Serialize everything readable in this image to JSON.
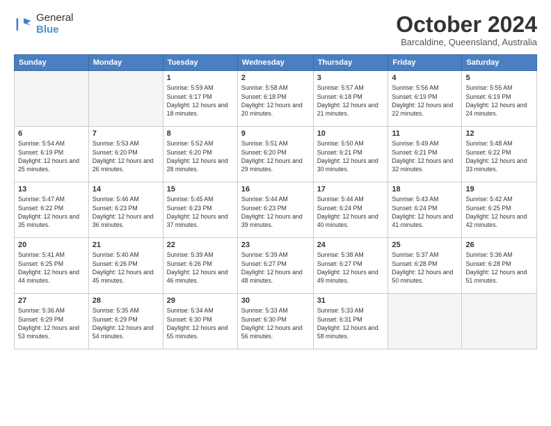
{
  "logo": {
    "general": "General",
    "blue": "Blue"
  },
  "header": {
    "month": "October 2024",
    "location": "Barcaldine, Queensland, Australia"
  },
  "days_of_week": [
    "Sunday",
    "Monday",
    "Tuesday",
    "Wednesday",
    "Thursday",
    "Friday",
    "Saturday"
  ],
  "weeks": [
    [
      {
        "day": "",
        "sunrise": "",
        "sunset": "",
        "daylight": ""
      },
      {
        "day": "",
        "sunrise": "",
        "sunset": "",
        "daylight": ""
      },
      {
        "day": "1",
        "sunrise": "Sunrise: 5:59 AM",
        "sunset": "Sunset: 6:17 PM",
        "daylight": "Daylight: 12 hours and 18 minutes."
      },
      {
        "day": "2",
        "sunrise": "Sunrise: 5:58 AM",
        "sunset": "Sunset: 6:18 PM",
        "daylight": "Daylight: 12 hours and 20 minutes."
      },
      {
        "day": "3",
        "sunrise": "Sunrise: 5:57 AM",
        "sunset": "Sunset: 6:18 PM",
        "daylight": "Daylight: 12 hours and 21 minutes."
      },
      {
        "day": "4",
        "sunrise": "Sunrise: 5:56 AM",
        "sunset": "Sunset: 6:19 PM",
        "daylight": "Daylight: 12 hours and 22 minutes."
      },
      {
        "day": "5",
        "sunrise": "Sunrise: 5:55 AM",
        "sunset": "Sunset: 6:19 PM",
        "daylight": "Daylight: 12 hours and 24 minutes."
      }
    ],
    [
      {
        "day": "6",
        "sunrise": "Sunrise: 5:54 AM",
        "sunset": "Sunset: 6:19 PM",
        "daylight": "Daylight: 12 hours and 25 minutes."
      },
      {
        "day": "7",
        "sunrise": "Sunrise: 5:53 AM",
        "sunset": "Sunset: 6:20 PM",
        "daylight": "Daylight: 12 hours and 26 minutes."
      },
      {
        "day": "8",
        "sunrise": "Sunrise: 5:52 AM",
        "sunset": "Sunset: 6:20 PM",
        "daylight": "Daylight: 12 hours and 28 minutes."
      },
      {
        "day": "9",
        "sunrise": "Sunrise: 5:51 AM",
        "sunset": "Sunset: 6:20 PM",
        "daylight": "Daylight: 12 hours and 29 minutes."
      },
      {
        "day": "10",
        "sunrise": "Sunrise: 5:50 AM",
        "sunset": "Sunset: 6:21 PM",
        "daylight": "Daylight: 12 hours and 30 minutes."
      },
      {
        "day": "11",
        "sunrise": "Sunrise: 5:49 AM",
        "sunset": "Sunset: 6:21 PM",
        "daylight": "Daylight: 12 hours and 32 minutes."
      },
      {
        "day": "12",
        "sunrise": "Sunrise: 5:48 AM",
        "sunset": "Sunset: 6:22 PM",
        "daylight": "Daylight: 12 hours and 33 minutes."
      }
    ],
    [
      {
        "day": "13",
        "sunrise": "Sunrise: 5:47 AM",
        "sunset": "Sunset: 6:22 PM",
        "daylight": "Daylight: 12 hours and 35 minutes."
      },
      {
        "day": "14",
        "sunrise": "Sunrise: 5:46 AM",
        "sunset": "Sunset: 6:23 PM",
        "daylight": "Daylight: 12 hours and 36 minutes."
      },
      {
        "day": "15",
        "sunrise": "Sunrise: 5:45 AM",
        "sunset": "Sunset: 6:23 PM",
        "daylight": "Daylight: 12 hours and 37 minutes."
      },
      {
        "day": "16",
        "sunrise": "Sunrise: 5:44 AM",
        "sunset": "Sunset: 6:23 PM",
        "daylight": "Daylight: 12 hours and 39 minutes."
      },
      {
        "day": "17",
        "sunrise": "Sunrise: 5:44 AM",
        "sunset": "Sunset: 6:24 PM",
        "daylight": "Daylight: 12 hours and 40 minutes."
      },
      {
        "day": "18",
        "sunrise": "Sunrise: 5:43 AM",
        "sunset": "Sunset: 6:24 PM",
        "daylight": "Daylight: 12 hours and 41 minutes."
      },
      {
        "day": "19",
        "sunrise": "Sunrise: 5:42 AM",
        "sunset": "Sunset: 6:25 PM",
        "daylight": "Daylight: 12 hours and 42 minutes."
      }
    ],
    [
      {
        "day": "20",
        "sunrise": "Sunrise: 5:41 AM",
        "sunset": "Sunset: 6:25 PM",
        "daylight": "Daylight: 12 hours and 44 minutes."
      },
      {
        "day": "21",
        "sunrise": "Sunrise: 5:40 AM",
        "sunset": "Sunset: 6:26 PM",
        "daylight": "Daylight: 12 hours and 45 minutes."
      },
      {
        "day": "22",
        "sunrise": "Sunrise: 5:39 AM",
        "sunset": "Sunset: 6:26 PM",
        "daylight": "Daylight: 12 hours and 46 minutes."
      },
      {
        "day": "23",
        "sunrise": "Sunrise: 5:39 AM",
        "sunset": "Sunset: 6:27 PM",
        "daylight": "Daylight: 12 hours and 48 minutes."
      },
      {
        "day": "24",
        "sunrise": "Sunrise: 5:38 AM",
        "sunset": "Sunset: 6:27 PM",
        "daylight": "Daylight: 12 hours and 49 minutes."
      },
      {
        "day": "25",
        "sunrise": "Sunrise: 5:37 AM",
        "sunset": "Sunset: 6:28 PM",
        "daylight": "Daylight: 12 hours and 50 minutes."
      },
      {
        "day": "26",
        "sunrise": "Sunrise: 5:36 AM",
        "sunset": "Sunset: 6:28 PM",
        "daylight": "Daylight: 12 hours and 51 minutes."
      }
    ],
    [
      {
        "day": "27",
        "sunrise": "Sunrise: 5:36 AM",
        "sunset": "Sunset: 6:29 PM",
        "daylight": "Daylight: 12 hours and 53 minutes."
      },
      {
        "day": "28",
        "sunrise": "Sunrise: 5:35 AM",
        "sunset": "Sunset: 6:29 PM",
        "daylight": "Daylight: 12 hours and 54 minutes."
      },
      {
        "day": "29",
        "sunrise": "Sunrise: 5:34 AM",
        "sunset": "Sunset: 6:30 PM",
        "daylight": "Daylight: 12 hours and 55 minutes."
      },
      {
        "day": "30",
        "sunrise": "Sunrise: 5:33 AM",
        "sunset": "Sunset: 6:30 PM",
        "daylight": "Daylight: 12 hours and 56 minutes."
      },
      {
        "day": "31",
        "sunrise": "Sunrise: 5:33 AM",
        "sunset": "Sunset: 6:31 PM",
        "daylight": "Daylight: 12 hours and 58 minutes."
      },
      {
        "day": "",
        "sunrise": "",
        "sunset": "",
        "daylight": ""
      },
      {
        "day": "",
        "sunrise": "",
        "sunset": "",
        "daylight": ""
      }
    ]
  ]
}
